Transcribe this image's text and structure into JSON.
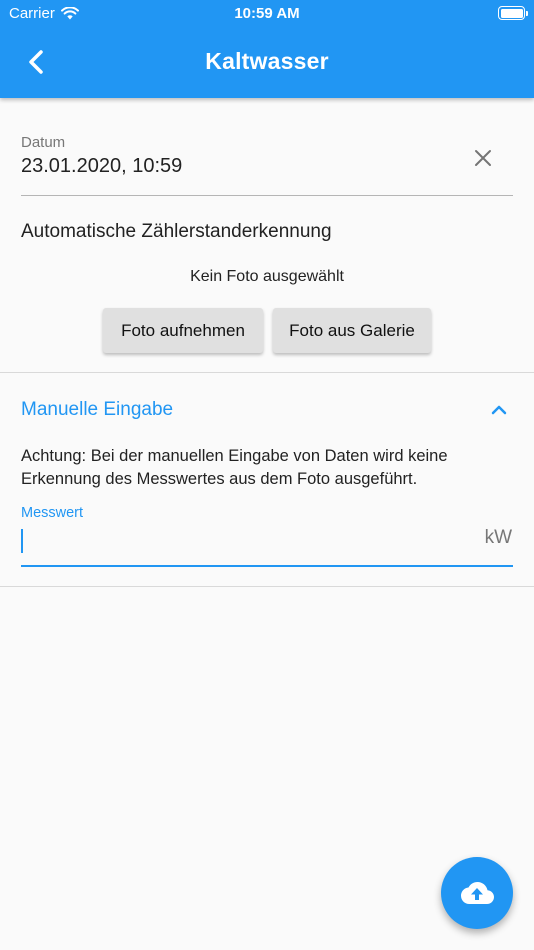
{
  "status_bar": {
    "carrier": "Carrier",
    "time": "10:59 AM",
    "icons": [
      "wifi-icon",
      "battery-icon"
    ]
  },
  "app_bar": {
    "title": "Kaltwasser",
    "back_icon": "chevron-left-icon",
    "color": "#2196f3"
  },
  "date_field": {
    "label": "Datum",
    "value": "23.01.2020, 10:59",
    "clear_icon": "close-icon"
  },
  "auto_recognition": {
    "heading": "Automatische Zählerstanderkennung",
    "status": "Kein Foto ausgewählt",
    "take_photo_label": "Foto aufnehmen",
    "gallery_label": "Foto aus Galerie"
  },
  "manual_entry": {
    "title": "Manuelle Eingabe",
    "toggle_icon": "chevron-up-icon",
    "warning": "Achtung: Bei der manuellen Eingabe von Daten wird keine Erkennung des Messwertes aus dem Foto ausgeführt.",
    "input": {
      "label": "Messwert",
      "value": "",
      "suffix": "kW"
    }
  },
  "fab": {
    "icon": "cloud-upload-icon"
  },
  "colors": {
    "accent": "#2196f3",
    "background": "#fafafa",
    "button": "#e0e0e0"
  }
}
